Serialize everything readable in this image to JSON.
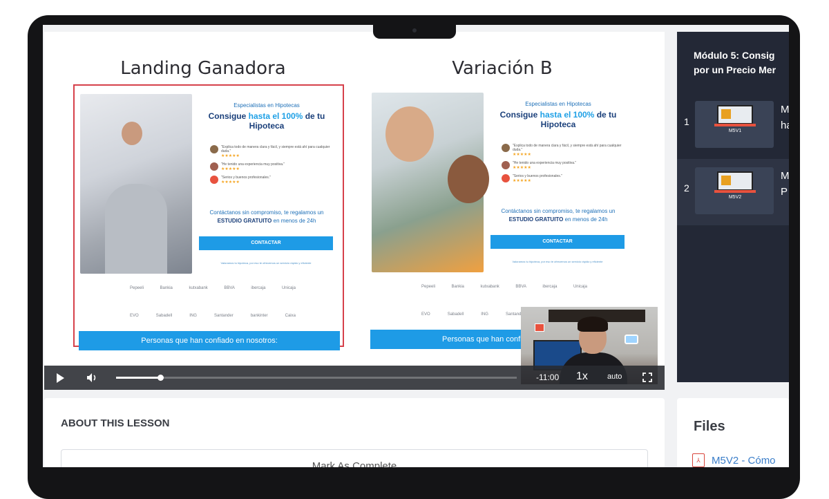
{
  "video": {
    "left_title": "Landing Ganadora",
    "right_title": "Variación B",
    "landing": {
      "kicker": "Especialistas en Hipotecas",
      "headline_pre": "Consigue ",
      "headline_hl": "hasta el 100%",
      "headline_post": " de tu Hipoteca",
      "reviews": [
        {
          "text": "\"Explica todo de manera clara y fácil, y siempre está ahí para cualquier duda.\"",
          "stars": "★★★★★",
          "color": "#8a6a4a"
        },
        {
          "text": "\"He tenido una experiencia muy positiva.\"",
          "stars": "★★★★★",
          "color": "#a06050"
        },
        {
          "text": "\"Serios y buenos profesionales.\"",
          "stars": "★★★★★",
          "color": "#e8523e"
        }
      ],
      "cta_line1": "Contáctanos sin compromiso, te regalamos un",
      "cta_bold": "ESTUDIO GRATUITO",
      "cta_line2": " en menos de 24h",
      "cta_button": "CONTACTAR",
      "fineprint": "Valoramos tu hipoteca, por eso te ofrecemos un servicio rápido y eficiente",
      "logos_row1": [
        "Pepeeli",
        "Bankia",
        "kutxabank",
        "BBVA",
        "ibercaja",
        "Unicaja"
      ],
      "logos_row2": [
        "EVO",
        "Sabadell",
        "ING",
        "Santander",
        "bankinter",
        "Caixa"
      ],
      "trust_bar": "Personas que han confiado en nosotros:",
      "trust_bar_b": "Personas que han confiad"
    },
    "controls": {
      "play_icon": "play-icon",
      "volume_icon": "volume-icon",
      "progress": 0.11,
      "time": "-11:00",
      "speed": "1x",
      "quality": "auto",
      "fullscreen_icon": "fullscreen-icon"
    }
  },
  "sidebar": {
    "module_title_line1": "Módulo 5: Consig",
    "module_title_line2": "por un Precio Mer",
    "lessons": [
      {
        "num": "1",
        "code": "M5V1",
        "title_line1": "M",
        "title_line2": "ha",
        "active": false
      },
      {
        "num": "2",
        "code": "M5V2",
        "title_line1": "M",
        "title_line2": "P",
        "active": true
      }
    ]
  },
  "about": {
    "heading": "ABOUT THIS LESSON",
    "mark_button": "Mark As Complete"
  },
  "files": {
    "heading": "Files",
    "items": [
      {
        "name": "M5V2 - Cómo",
        "icon": "pdf-icon"
      }
    ]
  },
  "colors": {
    "sidebar_bg": "#232836",
    "accent_blue": "#1e9be6",
    "winner_border": "#d6404a",
    "link": "#3b7ec9"
  }
}
